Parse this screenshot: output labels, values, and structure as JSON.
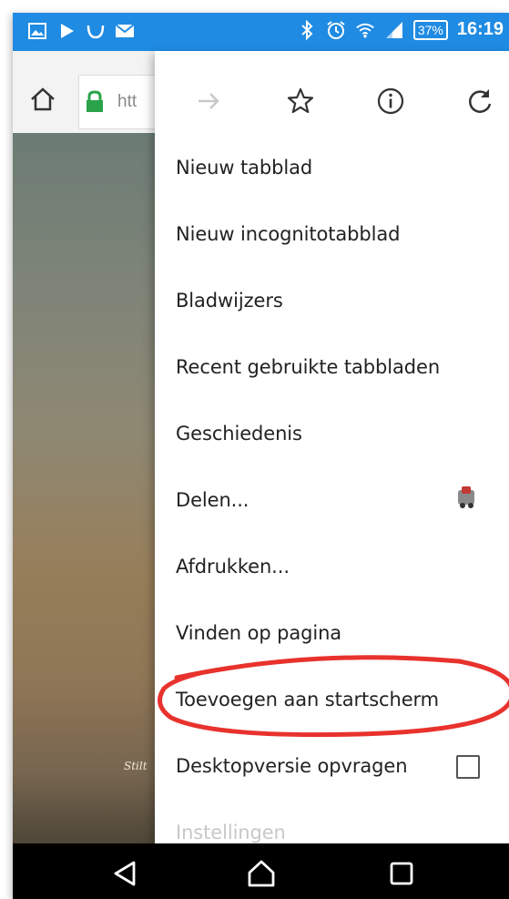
{
  "status_bar": {
    "left_icons": [
      "image-icon",
      "play-icon",
      "messenger-icon",
      "mail-icon"
    ],
    "right_icons": [
      "bluetooth-icon",
      "alarm-icon",
      "wifi-icon",
      "signal-icon"
    ],
    "battery": "37%",
    "time": "16:19"
  },
  "toolbar": {
    "url_text": "htt"
  },
  "page": {
    "caption": "Stilt"
  },
  "menu": {
    "items": [
      {
        "label": "Nieuw tabblad"
      },
      {
        "label": "Nieuw incognitotabblad"
      },
      {
        "label": "Bladwijzers"
      },
      {
        "label": "Recent gebruikte tabbladen"
      },
      {
        "label": "Geschiedenis"
      },
      {
        "label": "Delen..."
      },
      {
        "label": "Afdrukken..."
      },
      {
        "label": "Vinden op pagina"
      },
      {
        "label": "Toevoegen aan startscherm"
      },
      {
        "label": "Desktopversie opvragen",
        "checked": false
      },
      {
        "label": "Instellingen"
      }
    ]
  },
  "colors": {
    "status_bar": "#1f8be3",
    "annotation": "#e8322d",
    "lock": "#2aa34a"
  }
}
